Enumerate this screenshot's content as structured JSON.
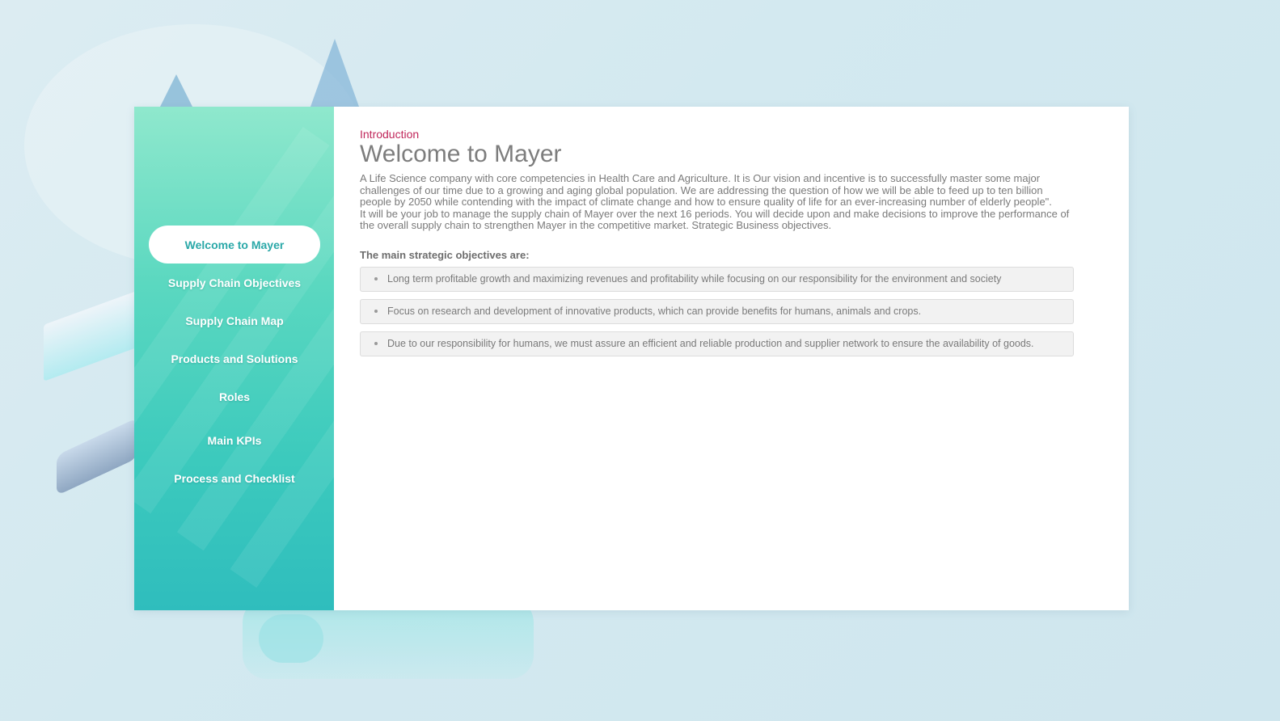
{
  "sidebar": {
    "items": [
      {
        "label": "Welcome to Mayer",
        "active": true
      },
      {
        "label": "Supply Chain Objectives",
        "active": false
      },
      {
        "label": "Supply Chain Map",
        "active": false
      },
      {
        "label": "Products and Solutions",
        "active": false
      },
      {
        "label": "Roles",
        "active": false
      },
      {
        "label": "Main KPIs",
        "active": false
      },
      {
        "label": "Process and Checklist",
        "active": false
      }
    ]
  },
  "main": {
    "section_label": "Introduction",
    "title": "Welcome to Mayer",
    "intro_paragraph_1": "A Life Science company with core competencies in Health Care and Agriculture. It is Our vision and incentive is to successfully master some major challenges of our time due to a growing and aging global population. We are addressing the question of how we will be able to feed up to ten billion people by 2050 while contending with the impact of climate change and how to ensure quality of life for an ever-increasing number of elderly people\".",
    "intro_paragraph_2": "It will be your job to manage the supply chain of Mayer over the next 16 periods. You will decide upon and make decisions to improve the performance of the overall supply chain to strengthen Mayer in the competitive market. Strategic Business objectives.",
    "objectives_heading": "The main strategic objectives are:",
    "objectives": [
      "Long term profitable growth and maximizing revenues and profitability while focusing on our responsibility for the environment and society",
      "Focus on research and development of innovative products, which can provide benefits for humans, animals and crops.",
      "Due to our responsibility for humans, we must assure an efficient and reliable production and supplier network to ensure the availability of goods."
    ]
  },
  "colors": {
    "accent_red": "#c0265a",
    "active_nav_text": "#2aa8a8",
    "sidebar_top": "#8fe8cd",
    "sidebar_bottom": "#2fbdbd"
  }
}
